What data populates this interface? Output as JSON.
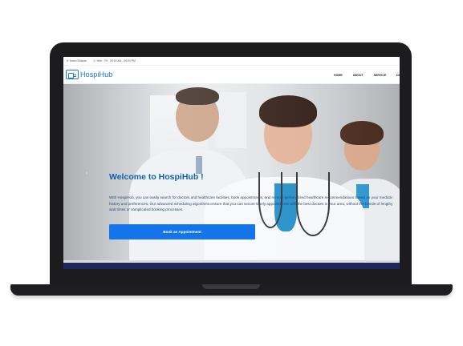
{
  "topbar": {
    "location": "Aravo Bhavan",
    "hours": "Mon - Fri : 09:00 AM - 09:00 PM"
  },
  "brand": {
    "name": "HospiHub"
  },
  "nav": {
    "items": [
      "HOME",
      "ABOUT",
      "SERVICE",
      "DI"
    ]
  },
  "hero": {
    "title": "Welcome to HospiHub !",
    "description": "With HospiHub, you can easily search for doctors and healthcare facilities, book appointments, and receive personalized healthcare recommendations based on your medical history and preferences. Our advanced scheduling algorithms ensure that you can secure timely appointments with the best doctors in your area, without the hassle of lengthy wait times or complicated booking processes.",
    "cta_label": "Book an Appointment",
    "prev_arrow": "‹"
  },
  "colors": {
    "brand_blue": "#1474e9",
    "title_blue": "#0f5fb3",
    "footer_navy": "#20285a"
  },
  "icons": {
    "location": "map-pin-icon",
    "clock": "clock-icon",
    "logo": "hospital-logo-icon"
  }
}
